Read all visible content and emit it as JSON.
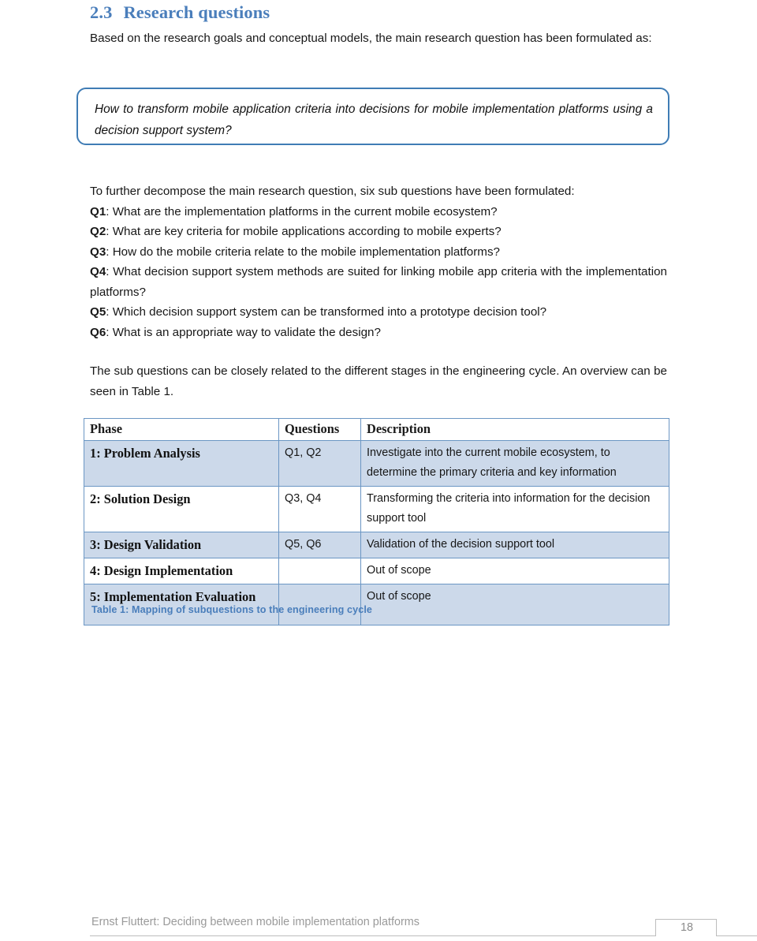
{
  "document": {
    "section": {
      "number": "2.3",
      "title": "Research questions"
    },
    "intro_paragraph": "Based on the research goals and conceptual models, the main research question has been formulated as:",
    "main_question_box": {
      "text": "How to transform mobile application criteria into decisions for mobile implementation platforms using a decision support system?",
      "border_color": "#3f7cb5"
    },
    "decompose_paragraph": "To further decompose the main research question, six sub questions have been formulated:",
    "sub_questions": [
      {
        "label": "Q1",
        "text": ": What are the implementation platforms in the current mobile ecosystem?"
      },
      {
        "label": "Q2",
        "text": ": What are key criteria for mobile applications according to mobile experts?"
      },
      {
        "label": "Q3",
        "text": ": How do the mobile criteria relate to the mobile implementation platforms?"
      },
      {
        "label": "Q4",
        "text": ": What decision support system methods are suited for linking mobile app criteria with the implementation platforms?"
      },
      {
        "label": "Q5",
        "text": ": Which decision support system can be transformed into a prototype decision tool?"
      },
      {
        "label": "Q6",
        "text": ": What is an appropriate way to validate the design?"
      }
    ],
    "overview_paragraph": "The sub questions can be closely related to the different stages in the engineering cycle. An overview can be seen in Table 1.",
    "table": {
      "headers": [
        "Phase",
        "Questions",
        "Description"
      ],
      "rows": [
        {
          "phase": "1: Problem Analysis",
          "questions": "Q1, Q2",
          "description": "Investigate into the current mobile ecosystem, to determine the primary criteria and key information",
          "shaded": true
        },
        {
          "phase": "2: Solution Design",
          "questions": "Q3, Q4",
          "description": "Transforming the criteria into information for the decision support tool",
          "shaded": false
        },
        {
          "phase": "3: Design Validation",
          "questions": "Q5, Q6",
          "description": "Validation of the decision support tool",
          "shaded": true
        },
        {
          "phase": "4: Design Implementation",
          "questions": "",
          "description": "Out of scope",
          "shaded": false
        },
        {
          "phase": "5: Implementation Evaluation",
          "questions": "",
          "description": "Out of scope",
          "shaded": true
        }
      ],
      "caption": "Table 1: Mapping of subquestions to the engineering cycle",
      "caption_color": "#4a7ebb",
      "border_color": "#6b96c4",
      "shade_color": "#ccd9ea"
    },
    "footer": {
      "text": "Ernst Fluttert: Deciding between mobile implementation platforms",
      "page_number": "18"
    }
  }
}
